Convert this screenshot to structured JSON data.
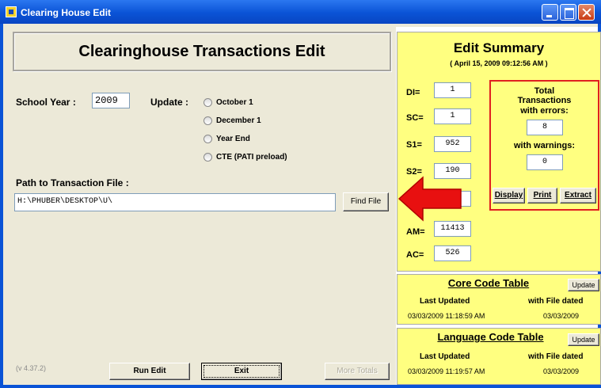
{
  "window": {
    "title": "Clearing House Edit"
  },
  "header": {
    "title": "Clearinghouse  Transactions  Edit"
  },
  "school_year": {
    "label": "School Year :",
    "value": "2009"
  },
  "update": {
    "label": "Update :",
    "options": [
      "October 1",
      "December 1",
      "Year End",
      "CTE (PATI preload)"
    ]
  },
  "path": {
    "label": "Path to Transaction File :",
    "value": "H:\\PHUBER\\DESKTOP\\U\\",
    "find_file_label": "Find File"
  },
  "footer": {
    "version": "(v 4.37.2)",
    "run_edit_label": "Run Edit",
    "exit_label": "Exit",
    "more_totals_label": "More Totals"
  },
  "summary": {
    "title": "Edit  Summary",
    "date": "( April 15, 2009   09:12:56 AM )",
    "counts": [
      {
        "label": "DI=",
        "value": "1"
      },
      {
        "label": "SC=",
        "value": "1"
      },
      {
        "label": "S1=",
        "value": "952"
      },
      {
        "label": "S2=",
        "value": "190"
      },
      {
        "label": "",
        "value": ""
      },
      {
        "label": "AM=",
        "value": "11413"
      },
      {
        "label": "AC=",
        "value": "526"
      }
    ],
    "totals": {
      "title": "Total Transactions",
      "errors_label": "with errors:",
      "errors_value": "8",
      "warnings_label": "with warnings:",
      "warnings_value": "0",
      "display_label": "Display",
      "print_label": "Print",
      "extract_label": "Extract"
    }
  },
  "core_table": {
    "title": "Core Code Table",
    "update_label": "Update",
    "last_updated_label": "Last Updated",
    "file_dated_label": "with File dated",
    "last_updated": "03/03/2009  11:18:59 AM",
    "file_dated": "03/03/2009"
  },
  "language_table": {
    "title": "Language Code Table",
    "update_label": "Update",
    "last_updated_label": "Last Updated",
    "file_dated_label": "with File dated",
    "last_updated": "03/03/2009  11:19:57 AM",
    "file_dated": "03/03/2009"
  },
  "colors": {
    "title_bar": "#0a53d6",
    "panel_yellow": "#ffff80",
    "totals_border": "#e02020",
    "arrow": "#e81010"
  }
}
